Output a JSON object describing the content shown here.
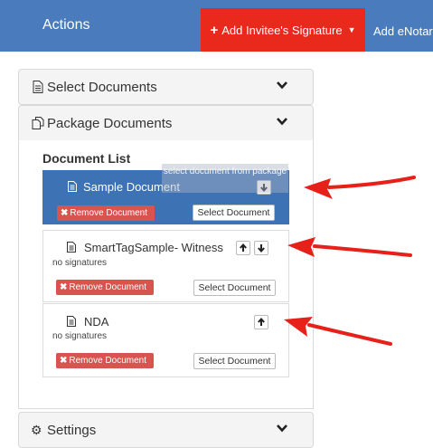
{
  "header": {
    "title": "Actions",
    "add_signature_label": "Add Invitee's Signature",
    "add_enotary_label": "Add eNotar"
  },
  "panels": {
    "select_documents": "Select Documents",
    "package_documents": "Package Documents",
    "settings": "Settings"
  },
  "document_list": {
    "title": "Document List",
    "tooltip": "select document from package",
    "items": [
      {
        "name": "Sample Document",
        "subtitle": "",
        "remove_label": "Remove Document",
        "select_label": "Select Document"
      },
      {
        "name": "SmartTagSample- Witness",
        "subtitle": "no signatures",
        "remove_label": "Remove Document",
        "select_label": "Select Document"
      },
      {
        "name": "NDA",
        "subtitle": "no signatures",
        "remove_label": "Remove Document",
        "select_label": "Select Document"
      }
    ]
  },
  "colors": {
    "header_bg": "#4a7cbd",
    "add_signature_bg": "#e8291c",
    "selected_item_bg": "#3d72b4",
    "remove_button_bg": "#d9534f",
    "annotation_arrow": "#e8201a"
  },
  "icons": [
    "document-icon",
    "packages-icon",
    "gear-icon",
    "chevron-down-icon",
    "arrow-up-icon",
    "arrow-down-icon",
    "plus-icon",
    "close-icon"
  ]
}
